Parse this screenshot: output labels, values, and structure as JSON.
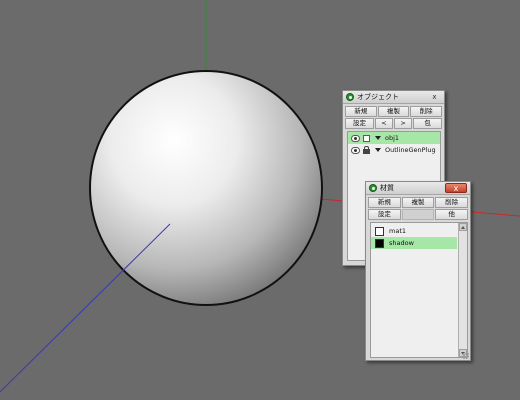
{
  "colors": {
    "background": "#6b6b6b",
    "axis_y": "#2f8f2f",
    "axis_x": "#c62a2a",
    "axis_z": "#3a3ab5",
    "selected_row": "#a6e6a6"
  },
  "viewport": {
    "object": "sphere",
    "axes": [
      "x-axis",
      "y-axis",
      "z-axis"
    ]
  },
  "object_panel": {
    "title": "オブジェクト",
    "close_glyph": "x",
    "buttons_row1": [
      "新規",
      "複製",
      "削除"
    ],
    "buttons_row2": [
      "設定",
      "<",
      ">",
      "包"
    ],
    "items": [
      {
        "name": "obj1",
        "selected": true,
        "lock_icon": "checkbox"
      },
      {
        "name": "OutlineGenPlug",
        "selected": false,
        "lock_icon": "lock-icon"
      }
    ]
  },
  "material_panel": {
    "title": "材質",
    "close_glyph": "x",
    "buttons_row1": [
      "新規",
      "複製",
      "削除"
    ],
    "buttons_row2": [
      "設定",
      "",
      "他"
    ],
    "items": [
      {
        "name": "mat1",
        "color": "#ffffff",
        "selected": false
      },
      {
        "name": "shadow",
        "color": "#000000",
        "selected": true
      }
    ]
  }
}
